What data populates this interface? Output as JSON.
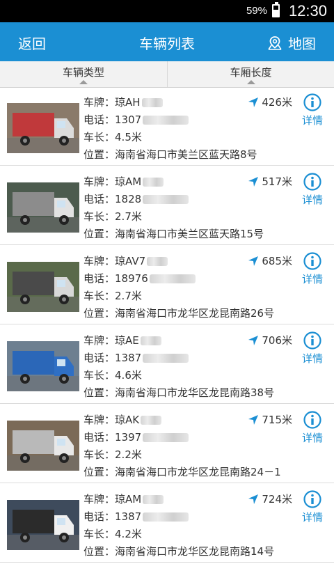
{
  "status_bar": {
    "battery": "59%",
    "battery_level": 0.59,
    "time": "12:30"
  },
  "header": {
    "back_label": "返回",
    "title": "车辆列表",
    "map_label": "地图"
  },
  "filters": [
    {
      "label": "车辆类型"
    },
    {
      "label": "车厢长度"
    }
  ],
  "labels": {
    "plate": "车牌：",
    "phone": "电话：",
    "length": "车长：",
    "location": "位置：",
    "detail": "详情"
  },
  "colors": {
    "header": "#1b8fd3",
    "accent": "#1b8fd3"
  },
  "vehicles": [
    {
      "plate_prefix": "琼AH",
      "phone_prefix": "1307",
      "length": "4.5米",
      "location": "海南省海口市美兰区蓝天路8号",
      "distance": "426米"
    },
    {
      "plate_prefix": "琼AM",
      "phone_prefix": "1828",
      "length": "2.7米",
      "location": "海南省海口市美兰区蓝天路15号",
      "distance": "517米"
    },
    {
      "plate_prefix": "琼AV7",
      "phone_prefix": "18976",
      "length": "2.7米",
      "location": "海南省海口市龙华区龙昆南路26号",
      "distance": "685米"
    },
    {
      "plate_prefix": "琼AE",
      "phone_prefix": "1387",
      "length": "4.6米",
      "location": "海南省海口市龙华区龙昆南路38号",
      "distance": "706米"
    },
    {
      "plate_prefix": "琼AK",
      "phone_prefix": "1397",
      "length": "2.2米",
      "location": "海南省海口市龙华区龙昆南路24－1",
      "distance": "715米"
    },
    {
      "plate_prefix": "琼AM",
      "phone_prefix": "1387",
      "length": "4.2米",
      "location": "海南省海口市龙华区龙昆南路14号",
      "distance": "724米"
    }
  ]
}
